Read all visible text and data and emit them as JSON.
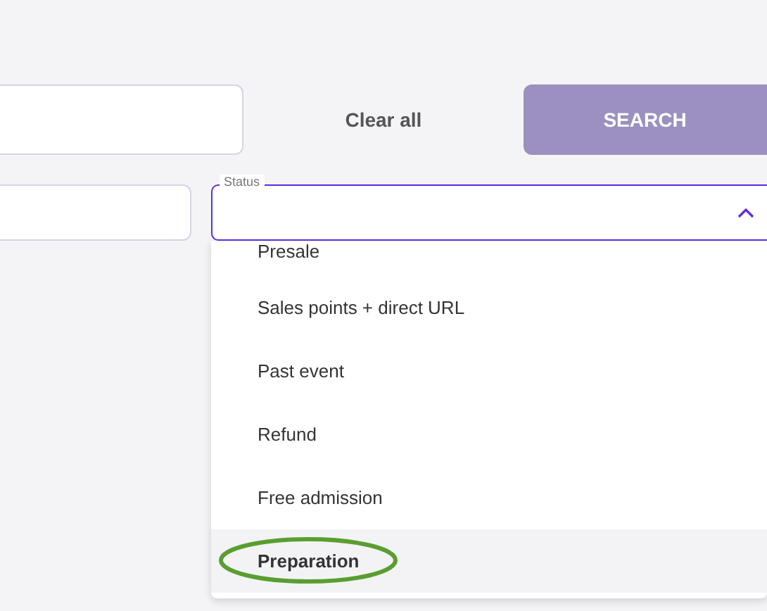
{
  "filters": {
    "clear_button": "Clear all",
    "search_button": {
      "label": "SEARCH",
      "disabled": true
    }
  },
  "status_field": {
    "label": "Status",
    "expanded": true
  },
  "status_options": [
    {
      "label": "Presale",
      "selected": false,
      "highlighted": false
    },
    {
      "label": "Sales points + direct URL",
      "selected": false,
      "highlighted": false
    },
    {
      "label": "Past event",
      "selected": false,
      "highlighted": false
    },
    {
      "label": "Refund",
      "selected": false,
      "highlighted": false
    },
    {
      "label": "Free admission",
      "selected": false,
      "highlighted": false
    },
    {
      "label": "Preparation",
      "selected": true,
      "highlighted": true
    }
  ]
}
